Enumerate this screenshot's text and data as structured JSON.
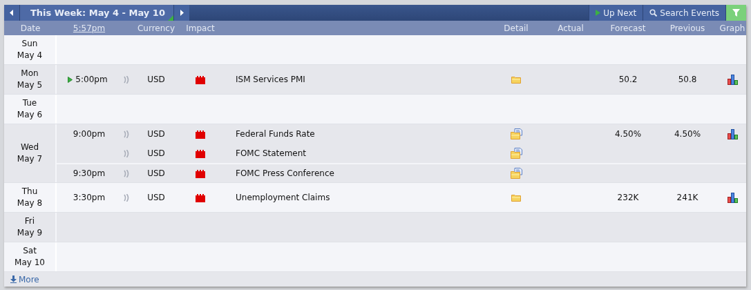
{
  "toolbar": {
    "title": "This Week: May 4 - May 10",
    "buttons": [
      {
        "label": "Up Next",
        "kind": "upnext"
      },
      {
        "label": "Search Events",
        "kind": "search"
      },
      {
        "kind": "filter"
      }
    ]
  },
  "columns": [
    {
      "label": "Date"
    },
    {
      "label": "5:57pm",
      "kind": "link"
    },
    {
      "label": "Currency"
    },
    {
      "label": "Impact"
    },
    {
      "label": "Detail"
    },
    {
      "label": "Actual"
    },
    {
      "label": "Forecast"
    },
    {
      "label": "Previous"
    },
    {
      "label": "Graph"
    }
  ],
  "days": [
    {
      "weekday": "Sun",
      "date": "May 4"
    },
    {
      "weekday": "Mon",
      "date": "May 5",
      "events": [
        {
          "time": "5:00pm",
          "upcoming": true,
          "currency": "USD",
          "color": "#e00000",
          "title": "ISM Services PMI",
          "detail_page": false,
          "forecast": "50.2",
          "previous": "50.8",
          "graph": true
        }
      ]
    },
    {
      "weekday": "Tue",
      "date": "May 6"
    },
    {
      "weekday": "Wed",
      "date": "May 7",
      "events": [
        {
          "time": "9:00pm",
          "upcoming": false,
          "currency": "USD",
          "color": "#e00000",
          "title": "Federal Funds Rate",
          "detail_page": true,
          "forecast": "4.50%",
          "previous": "4.50%",
          "graph": true
        },
        {
          "upcoming": false,
          "currency": "USD",
          "color": "#e00000",
          "title": "FOMC Statement",
          "detail_page": true,
          "graph": false
        },
        {
          "time": "9:30pm",
          "upcoming": false,
          "currency": "USD",
          "color": "#e00000",
          "title": "FOMC Press Conference",
          "detail_page": true,
          "graph": false
        }
      ]
    },
    {
      "weekday": "Thu",
      "date": "May 8",
      "events": [
        {
          "time": "3:30pm",
          "upcoming": false,
          "currency": "USD",
          "color": "#e00000",
          "title": "Unemployment Claims",
          "detail_page": false,
          "forecast": "232K",
          "previous": "241K",
          "graph": true
        }
      ]
    },
    {
      "weekday": "Fri",
      "date": "May 9"
    },
    {
      "weekday": "Sat",
      "date": "May 10"
    }
  ],
  "footer": {
    "label": "More"
  }
}
